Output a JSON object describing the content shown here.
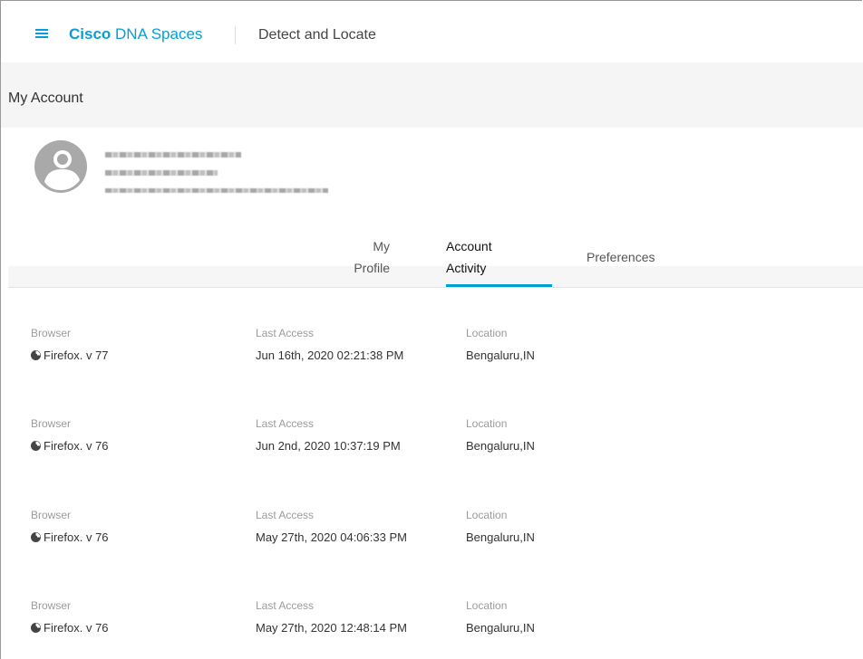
{
  "header": {
    "brand_bold": "Cisco",
    "brand_rest": "DNA Spaces",
    "app_title": "Detect and Locate"
  },
  "page": {
    "title": "My Account"
  },
  "tabs": [
    {
      "line1": "My",
      "line2": "Profile",
      "active": false
    },
    {
      "line1": "Account",
      "line2": "Activity",
      "active": true
    },
    {
      "line1": "Preferences",
      "active": false
    }
  ],
  "activity": {
    "labels": {
      "browser": "Browser",
      "last_access": "Last Access",
      "location": "Location"
    },
    "rows": [
      {
        "browser": "Firefox. v 77",
        "last_access": "Jun 16th, 2020 02:21:38 PM",
        "location": "Bengaluru,IN"
      },
      {
        "browser": "Firefox. v 76",
        "last_access": "Jun 2nd, 2020 10:37:19 PM",
        "location": "Bengaluru,IN"
      },
      {
        "browser": "Firefox. v 76",
        "last_access": "May 27th, 2020 04:06:33 PM",
        "location": "Bengaluru,IN"
      },
      {
        "browser": "Firefox. v 76",
        "last_access": "May 27th, 2020 12:48:14 PM",
        "location": "Bengaluru,IN"
      }
    ]
  },
  "icons": {
    "menu": "hamburger-icon",
    "avatar": "user-avatar-icon",
    "browser": "firefox-icon"
  },
  "colors": {
    "accent": "#049fd9"
  }
}
